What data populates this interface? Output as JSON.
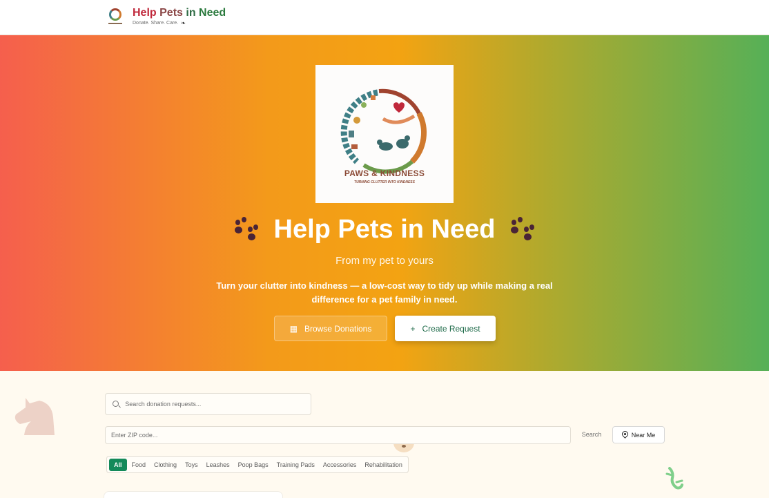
{
  "header": {
    "title_words": [
      "Help",
      "Pets",
      "in",
      "Need"
    ],
    "tagline": "Donate. Share. Care.",
    "tag_icon": "paw-icon"
  },
  "hero": {
    "logo": {
      "name": "PAWS & KINDNESS",
      "sub": "TURNING CLUTTER INTO KINDNESS"
    },
    "title": "Help Pets in Need",
    "title_icon": "paw-prints-icon",
    "subtitle": "From my pet to yours",
    "description": "Turn your clutter into kindness — a low-cost way to tidy up while making a real difference for a pet family in need.",
    "browse_label": "Browse Donations",
    "browse_icon": "grid-icon",
    "create_label": "Create Request",
    "create_icon": "plus-icon"
  },
  "search": {
    "placeholder": "Search donation requests...",
    "zip_placeholder": "Enter ZIP code...",
    "search_label": "Search",
    "near_label": "Near Me"
  },
  "categories": [
    "All",
    "Food",
    "Clothing",
    "Toys",
    "Leashes",
    "Poop Bags",
    "Training Pads",
    "Accessories",
    "Rehabilitation"
  ],
  "active_category": "All",
  "colors": {
    "accent_green": "#148a5a",
    "gradient": [
      "#f55f4d",
      "#f3a312",
      "#56b057"
    ],
    "title_red": "#c0283b",
    "title_green": "#2b7a3e"
  }
}
